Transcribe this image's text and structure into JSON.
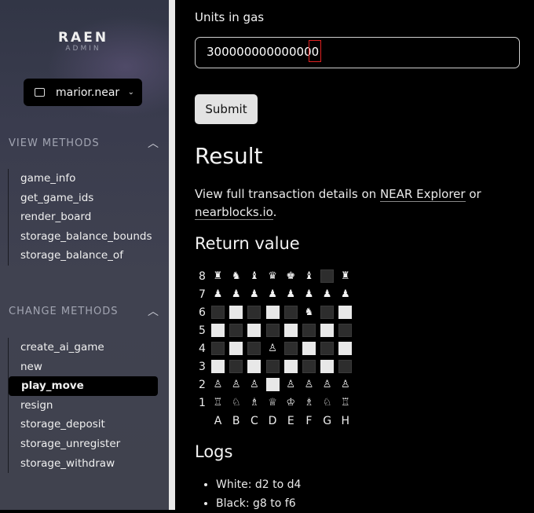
{
  "sidebar": {
    "logo_title": "RAEN",
    "logo_subtitle": "ADMIN",
    "account": "marior.near",
    "view_heading": "VIEW METHODS",
    "view_methods": [
      "game_info",
      "get_game_ids",
      "render_board",
      "storage_balance_bounds",
      "storage_balance_of"
    ],
    "change_heading": "CHANGE METHODS",
    "change_methods": [
      "create_ai_game",
      "new",
      "play_move",
      "resign",
      "storage_deposit",
      "storage_unregister",
      "storage_withdraw"
    ],
    "active_method": "play_move"
  },
  "form": {
    "gas_label": "Units in gas",
    "gas_value": "300000000000000",
    "submit_label": "Submit"
  },
  "result": {
    "title": "Result",
    "text_prefix": "View full transaction details on ",
    "link1": "NEAR Explorer",
    "text_mid": " or",
    "link2": "nearblocks.io",
    "text_suffix": "."
  },
  "return_value": {
    "title": "Return value",
    "ranks": [
      "8",
      "7",
      "6",
      "5",
      "4",
      "3",
      "2",
      "1"
    ],
    "files": [
      "A",
      "B",
      "C",
      "D",
      "E",
      "F",
      "G",
      "H"
    ],
    "board": [
      [
        "♜",
        "♞",
        "♝",
        "♛",
        "♚",
        "♝",
        "⬛",
        "♜"
      ],
      [
        "♟",
        "♟",
        "♟",
        "♟",
        "♟",
        "♟",
        "♟",
        "♟"
      ],
      [
        "⬛",
        "⬜",
        "⬛",
        "⬜",
        "⬛",
        "♞",
        "⬛",
        "⬜"
      ],
      [
        "⬜",
        "⬛",
        "⬜",
        "⬛",
        "⬜",
        "⬛",
        "⬜",
        "⬛"
      ],
      [
        "⬛",
        "⬜",
        "⬛",
        "♙",
        "⬛",
        "⬜",
        "⬛",
        "⬜"
      ],
      [
        "⬜",
        "⬛",
        "⬜",
        "⬛",
        "⬜",
        "⬛",
        "⬜",
        "⬛"
      ],
      [
        "♙",
        "♙",
        "♙",
        "⬜",
        "♙",
        "♙",
        "♙",
        "♙"
      ],
      [
        "♖",
        "♘",
        "♗",
        "♕",
        "♔",
        "♗",
        "♘",
        "♖"
      ]
    ]
  },
  "logs": {
    "title": "Logs",
    "items": [
      "White: d2 to d4",
      "Black: g8 to f6"
    ]
  }
}
